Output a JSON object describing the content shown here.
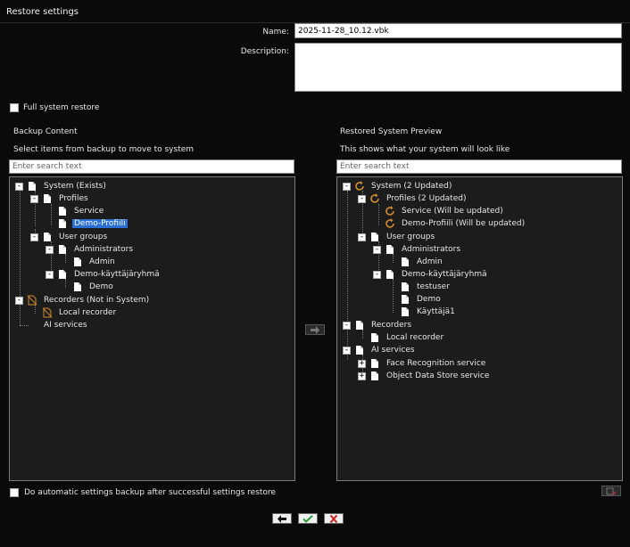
{
  "window": {
    "title": "Restore settings"
  },
  "form": {
    "name_label": "Name:",
    "name_value": "2025-11-28_10.12.vbk",
    "description_label": "Description:",
    "description_value": "",
    "full_restore_label": "Full system restore",
    "auto_backup_label": "Do automatic settings backup after successful settings restore"
  },
  "backup": {
    "title": "Backup Content",
    "subtitle": "Select items from backup to move to system",
    "search_placeholder": "Enter search text",
    "items": [
      {
        "label": "System (Exists)",
        "icon": "doc-icon",
        "expander": "-"
      },
      {
        "label": "Profiles",
        "icon": "doc-icon",
        "expander": "-"
      },
      {
        "label": "Service",
        "icon": "doc-icon",
        "expander": ""
      },
      {
        "label": "Demo-Profiili",
        "icon": "doc-icon",
        "expander": "",
        "selected": true
      },
      {
        "label": "User groups",
        "icon": "doc-icon",
        "expander": "-"
      },
      {
        "label": "Administrators",
        "icon": "doc-icon",
        "expander": "-"
      },
      {
        "label": "Admin",
        "icon": "doc-icon",
        "expander": ""
      },
      {
        "label": "Demo-käyttäjäryhmä",
        "icon": "doc-icon",
        "expander": "-"
      },
      {
        "label": "Demo",
        "icon": "doc-icon",
        "expander": ""
      },
      {
        "label": "Recorders (Not in System)",
        "icon": "doc-crossed-icon",
        "expander": "-"
      },
      {
        "label": "Local recorder",
        "icon": "doc-crossed-icon",
        "expander": ""
      },
      {
        "label": "AI services",
        "icon": "",
        "expander": ""
      }
    ]
  },
  "preview": {
    "title": "Restored System Preview",
    "subtitle": "This shows what your system will look like",
    "search_placeholder": "Enter search text",
    "items": [
      {
        "label": "System (2 Updated)",
        "icon": "refresh-icon",
        "expander": "-"
      },
      {
        "label": "Profiles (2 Updated)",
        "icon": "refresh-icon",
        "expander": "-"
      },
      {
        "label": "Service (Will be updated)",
        "icon": "refresh-icon",
        "expander": ""
      },
      {
        "label": "Demo-Profiili (Will be updated)",
        "icon": "refresh-icon",
        "expander": ""
      },
      {
        "label": "User groups",
        "icon": "doc-icon",
        "expander": "-"
      },
      {
        "label": "Administrators",
        "icon": "doc-icon",
        "expander": "-"
      },
      {
        "label": "Admin",
        "icon": "doc-icon",
        "expander": ""
      },
      {
        "label": "Demo-käyttäjäryhmä",
        "icon": "doc-icon",
        "expander": "-"
      },
      {
        "label": "testuser",
        "icon": "doc-icon",
        "expander": ""
      },
      {
        "label": "Demo",
        "icon": "doc-icon",
        "expander": ""
      },
      {
        "label": "Käyttäjä1",
        "icon": "doc-icon",
        "expander": ""
      },
      {
        "label": "Recorders",
        "icon": "doc-icon",
        "expander": "-"
      },
      {
        "label": "Local recorder",
        "icon": "doc-icon",
        "expander": ""
      },
      {
        "label": "AI services",
        "icon": "doc-icon",
        "expander": "-"
      },
      {
        "label": "Face Recognition service",
        "icon": "doc-icon",
        "expander": "+"
      },
      {
        "label": "Object Data Store service",
        "icon": "doc-icon",
        "expander": "+"
      }
    ]
  },
  "buttons": {
    "move": "arrow-right-icon",
    "remove": "remove-icon",
    "back": "arrow-left-icon",
    "ok": "check-icon",
    "cancel": "cross-icon"
  },
  "colors": {
    "background": "#0a0a0a",
    "tree_bg": "#1c1c1c",
    "selection": "#2a6fd6",
    "refresh_icon": "#d08a2c",
    "ok_green": "#2c9a3c",
    "cancel_red": "#d02020"
  }
}
